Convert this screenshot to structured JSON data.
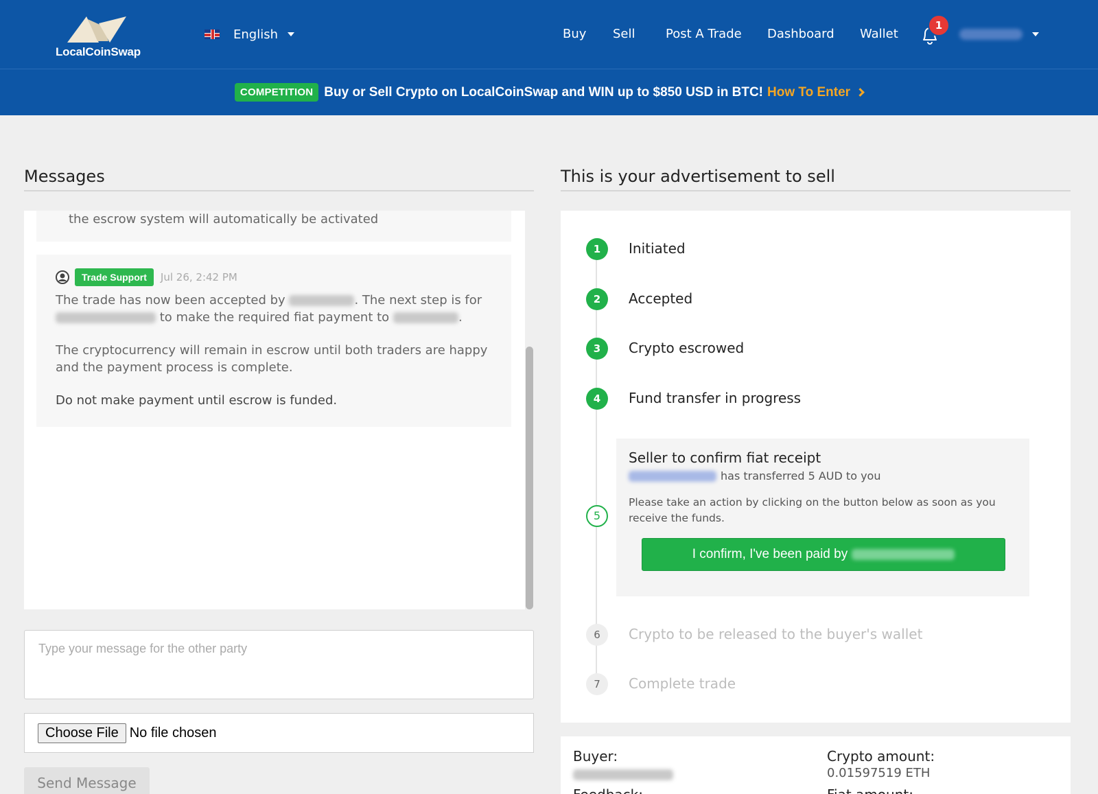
{
  "header": {
    "logo_text": "LocalCoinSwap",
    "language": "English",
    "nav": {
      "buy": "Buy",
      "sell": "Sell",
      "post_trade": "Post A Trade",
      "dashboard": "Dashboard",
      "wallet": "Wallet"
    },
    "notification_count": "1"
  },
  "banner": {
    "tag": "COMPETITION",
    "text": "Buy or Sell Crypto on LocalCoinSwap and WIN up to $850 USD in BTC!",
    "link": "How To Enter"
  },
  "messages": {
    "title": "Messages",
    "prev_message_tail": "the escrow system will automatically be activated",
    "support_message": {
      "author_tag": "Trade Support",
      "timestamp": "Jul 26, 2:42 PM",
      "p1_a": "The trade has now been accepted by",
      "p1_b": ". The next step is for",
      "p1_c": "to make the required fiat payment to",
      "p1_d": ".",
      "p2": "The cryptocurrency will remain in escrow until both traders are happy and the payment process is complete.",
      "p3": "Do not make payment until escrow is funded."
    },
    "input_placeholder": "Type your message for the other party",
    "choose_file_label": "Choose File",
    "file_status": "No file chosen",
    "send_label": "Send Message"
  },
  "trade": {
    "title": "This is your advertisement to sell",
    "steps": [
      {
        "num": "1",
        "label": "Initiated",
        "state": "done"
      },
      {
        "num": "2",
        "label": "Accepted",
        "state": "done"
      },
      {
        "num": "3",
        "label": "Crypto escrowed",
        "state": "done"
      },
      {
        "num": "4",
        "label": "Fund transfer in progress",
        "state": "done"
      },
      {
        "num": "5",
        "label": "Seller to confirm fiat receipt",
        "state": "current"
      },
      {
        "num": "6",
        "label": "Crypto to be released to the buyer's wallet",
        "state": "pending"
      },
      {
        "num": "7",
        "label": "Complete trade",
        "state": "pending"
      }
    ],
    "confirm": {
      "subtitle": "has transferred 5 AUD to you",
      "description": "Please take an action by clicking on the button below as soon as you receive the funds.",
      "button_label": "I confirm, I've been paid by"
    },
    "info": {
      "buyer_label": "Buyer:",
      "feedback_label": "Feedback:",
      "crypto_amount_label": "Crypto amount:",
      "crypto_amount_value": "0.01597519 ETH",
      "fiat_amount_label": "Fiat amount:"
    }
  },
  "colors": {
    "header_blue": "#0d56a6",
    "accent_green": "#21b14a",
    "link_orange": "#f5a623",
    "badge_red": "#e53935"
  }
}
